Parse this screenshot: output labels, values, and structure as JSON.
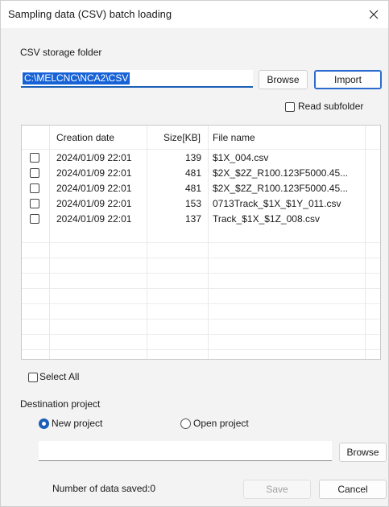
{
  "window": {
    "title": "Sampling data (CSV) batch loading"
  },
  "folder": {
    "label": "CSV storage folder",
    "value": "C:\\MELCNC\\NCA2\\CSV",
    "browse_label": "Browse",
    "import_label": "Import",
    "read_subfolder_label": "Read subfolder",
    "read_subfolder_checked": false
  },
  "table": {
    "columns": [
      "Creation date",
      "Size[KB]",
      "File name"
    ],
    "rows": [
      {
        "checked": false,
        "date": "2024/01/09 22:01",
        "size": "139",
        "name": "$1X_004.csv"
      },
      {
        "checked": false,
        "date": "2024/01/09 22:01",
        "size": "481",
        "name": "$2X_$2Z_R100.123F5000.45..."
      },
      {
        "checked": false,
        "date": "2024/01/09 22:01",
        "size": "481",
        "name": "$2X_$2Z_R100.123F5000.45..."
      },
      {
        "checked": false,
        "date": "2024/01/09 22:01",
        "size": "153",
        "name": "0713Track_$1X_$1Y_011.csv"
      },
      {
        "checked": false,
        "date": "2024/01/09 22:01",
        "size": "137",
        "name": "Track_$1X_$1Z_008.csv"
      }
    ]
  },
  "select_all": {
    "label": "Select All",
    "checked": false
  },
  "destination": {
    "label": "Destination project",
    "new_project_label": "New project",
    "open_project_label": "Open project",
    "selected": "New project",
    "path_value": "",
    "browse_label": "Browse"
  },
  "footer": {
    "saved_count_text": "Number of data saved:0",
    "save_label": "Save",
    "cancel_label": "Cancel"
  },
  "colors": {
    "accent": "#1b5fb8",
    "selection": "#1662d6"
  }
}
